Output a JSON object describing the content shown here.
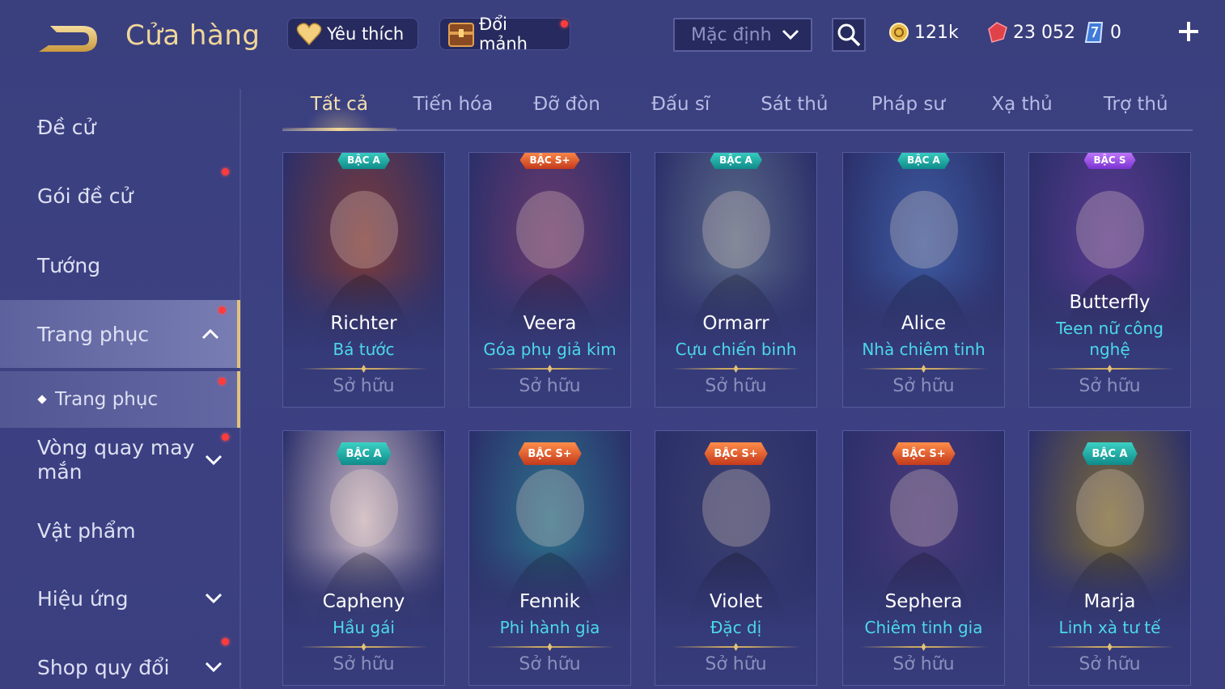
{
  "header": {
    "title": "Cửa hàng",
    "favorite_label": "Yêu thích",
    "shard_label": "Đổi mảnh",
    "sort_value": "Mặc định",
    "gold": "121k",
    "ruby": "23 052",
    "voucher": "0"
  },
  "sidebar": {
    "items": [
      {
        "label": "Đề cử"
      },
      {
        "label": "Gói đề cử"
      },
      {
        "label": "Tướng"
      },
      {
        "label": "Trang phục"
      },
      {
        "label": "Trang phục"
      },
      {
        "label": "Vòng quay may mắn"
      },
      {
        "label": "Vật phẩm"
      },
      {
        "label": "Hiệu ứng"
      },
      {
        "label": "Shop quy đổi"
      }
    ]
  },
  "tabs": [
    {
      "label": "Tất cả"
    },
    {
      "label": "Tiến hóa"
    },
    {
      "label": "Đỡ đòn"
    },
    {
      "label": "Đấu sĩ"
    },
    {
      "label": "Sát thủ"
    },
    {
      "label": "Pháp sư"
    },
    {
      "label": "Xạ thủ"
    },
    {
      "label": "Trợ thủ"
    }
  ],
  "cards": [
    {
      "hero": "Richter",
      "skin": "Bá tước",
      "tier": "BẬC A",
      "status": "Sở hữu",
      "theme": "#7a3b3b"
    },
    {
      "hero": "Veera",
      "skin": "Góa phụ giả kim",
      "tier": "BẬC S+",
      "status": "Sở hữu",
      "theme": "#6a3a6e"
    },
    {
      "hero": "Ormarr",
      "skin": "Cựu chiến binh",
      "tier": "BẬC A",
      "status": "Sở hữu",
      "theme": "#5b6a88"
    },
    {
      "hero": "Alice",
      "skin": "Nhà chiêm tinh",
      "tier": "BẬC A",
      "status": "Sở hữu",
      "theme": "#3c5aa0"
    },
    {
      "hero": "Butterfly",
      "skin": "Teen nữ công nghệ",
      "tier": "BẬC S",
      "status": "Sở hữu",
      "theme": "#5a3a8e"
    },
    {
      "hero": "Capheny",
      "skin": "Hầu gái",
      "tier": "BẬC A",
      "status": "Sở hữu",
      "theme": "#c9b8c4"
    },
    {
      "hero": "Fennik",
      "skin": "Phi hành gia",
      "tier": "BẬC S+",
      "status": "Sở hữu",
      "theme": "#2c6f8a"
    },
    {
      "hero": "Violet",
      "skin": "Đặc dị",
      "tier": "BẬC S+",
      "status": "Sở hữu",
      "theme": "#3a3f6e"
    },
    {
      "hero": "Sephera",
      "skin": "Chiêm tinh gia",
      "tier": "BẬC S+",
      "status": "Sở hữu",
      "theme": "#4a3a7a"
    },
    {
      "hero": "Marja",
      "skin": "Linh xà tư tế",
      "tier": "BẬC A",
      "status": "Sở hữu",
      "theme": "#7a6a3a"
    }
  ]
}
